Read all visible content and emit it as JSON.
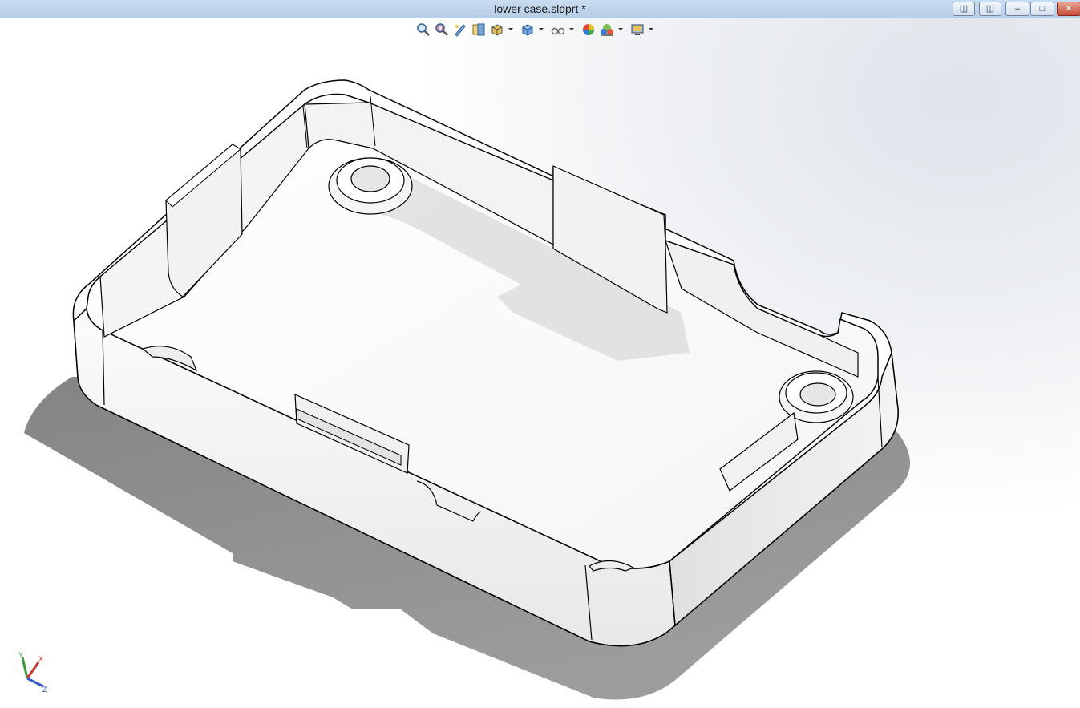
{
  "window": {
    "title": "lower case.sldprt *",
    "buttons": [
      "left-pane",
      "right-pane",
      "minimize",
      "restore",
      "close"
    ]
  },
  "view_toolbar": {
    "items": [
      {
        "icon": "zoom-to-fit-icon",
        "dropdown": false
      },
      {
        "icon": "zoom-to-area-icon",
        "dropdown": false
      },
      {
        "icon": "previous-view-icon",
        "dropdown": false
      },
      {
        "icon": "section-view-icon",
        "dropdown": false
      },
      {
        "icon": "view-orientation-icon",
        "dropdown": true
      },
      {
        "icon": "display-style-icon",
        "dropdown": true
      },
      {
        "icon": "hide-show-items-icon",
        "dropdown": true
      },
      {
        "icon": "edit-appearance-icon",
        "dropdown": false
      },
      {
        "icon": "apply-scene-icon",
        "dropdown": true
      },
      {
        "icon": "view-settings-icon",
        "dropdown": true
      }
    ]
  },
  "triad": {
    "x_label": "X",
    "y_label": "Y",
    "z_label": "Z"
  },
  "colors": {
    "title_bar": "#c2d6ee",
    "model_face": "#ffffff",
    "model_edge": "#000000",
    "shadow": "#8a8a8a"
  }
}
